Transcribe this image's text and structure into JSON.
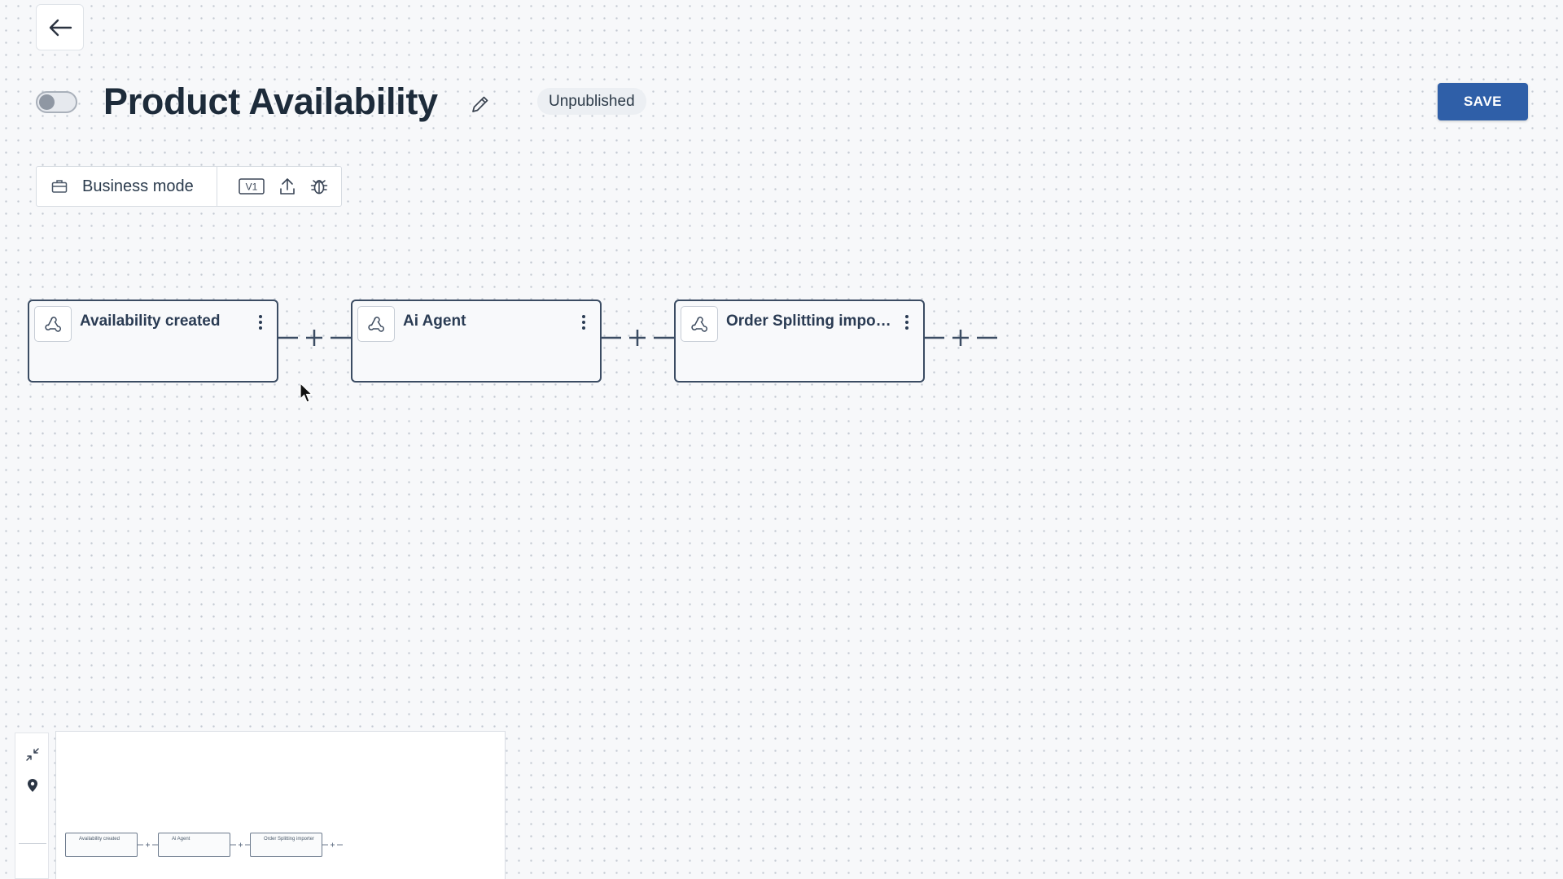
{
  "header": {
    "back_icon": "arrow-left-icon",
    "title": "Product Availability",
    "edit_icon": "pencil-icon",
    "status": "Unpublished",
    "save_label": "SAVE",
    "save_color": "#2f5fa8"
  },
  "workflow_toggle": {
    "enabled": false
  },
  "toolbar": {
    "mode_icon": "briefcase-icon",
    "mode_label": "Business mode",
    "version_label": "V1",
    "export_icon": "upload-icon",
    "debug_icon": "bug-icon"
  },
  "flow": {
    "nodes": [
      {
        "title": "Availability created",
        "icon": "webhook-icon"
      },
      {
        "title": "Ai Agent",
        "icon": "webhook-icon"
      },
      {
        "title": "Order Splitting import...",
        "icon": "webhook-icon"
      }
    ],
    "add_step_icon": "plus-icon"
  },
  "minimap": {
    "collapse_icon": "collapse-arrows-icon",
    "locate_icon": "location-pin-icon",
    "nodes": [
      {
        "title": "Availability created"
      },
      {
        "title": "Ai Agent"
      },
      {
        "title": "Order Splitting importer"
      }
    ]
  }
}
